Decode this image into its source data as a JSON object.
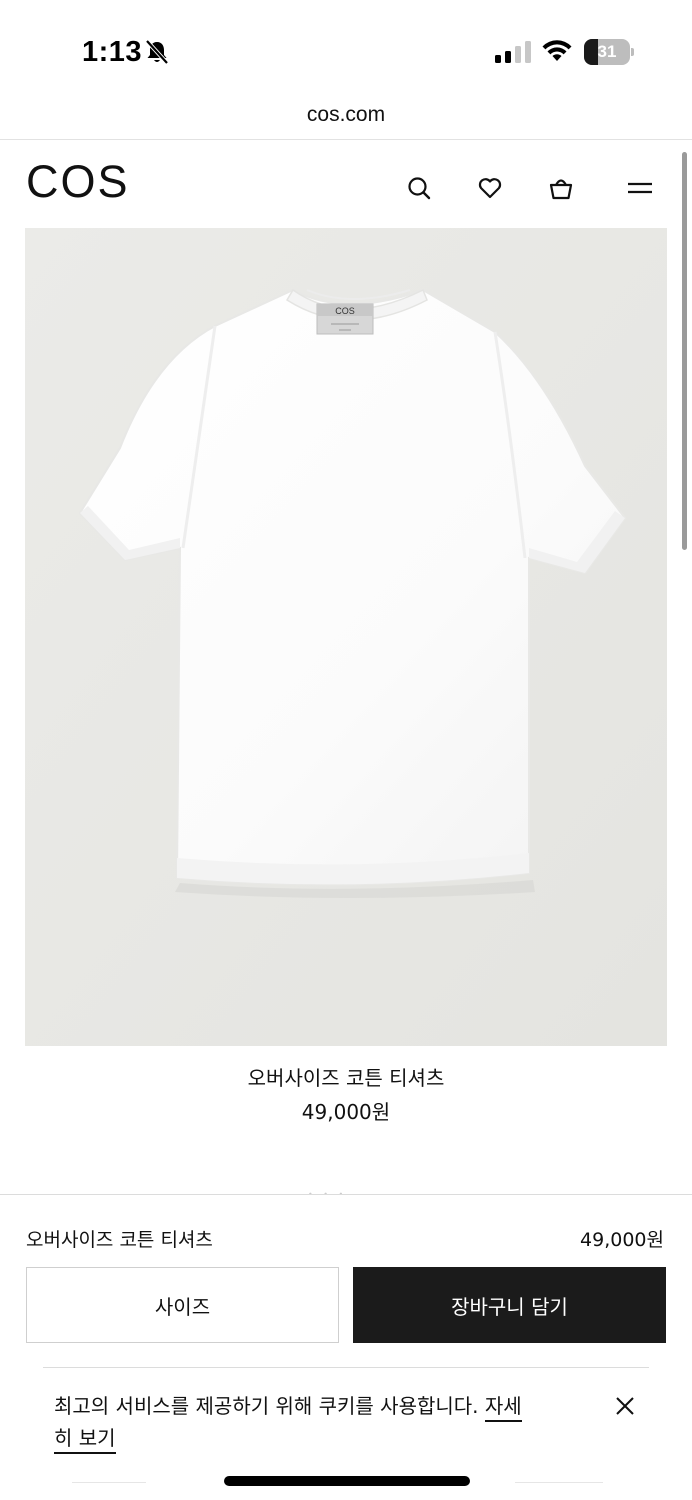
{
  "status_bar": {
    "time": "1:13",
    "battery_level": "31",
    "battery_fraction": 0.31,
    "icons": [
      "bell-slash-icon",
      "cellular-signal-icon",
      "wifi-icon",
      "battery-icon"
    ]
  },
  "browser": {
    "url": "cos.com"
  },
  "header": {
    "logo": "COS",
    "icons": [
      "search-icon",
      "heart-icon",
      "shopping-bag-icon",
      "menu-icon"
    ]
  },
  "product": {
    "name": "오버사이즈 코튼 티셔츠",
    "price": "49,000원",
    "garment_label_text": "COS"
  },
  "sticky_bar": {
    "name": "오버사이즈 코튼 티셔츠",
    "price": "49,000원",
    "size_button": "사이즈",
    "add_to_cart_button": "장바구니 담기"
  },
  "cookie_banner": {
    "text": "최고의 서비스를 제공하기 위해 쿠키를 사용합니다.",
    "link": "자세히 보기"
  },
  "colors": {
    "image_background": "#e9e9e6",
    "primary_button": "#1b1b1b",
    "text": "#111111"
  }
}
